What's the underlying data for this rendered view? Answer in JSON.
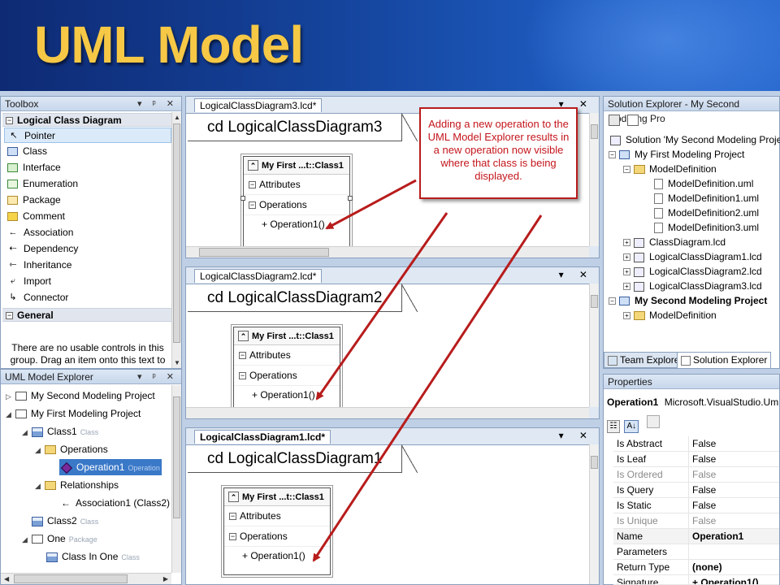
{
  "slide": {
    "title": "UML Model"
  },
  "toolbox": {
    "title": "Toolbox",
    "controls": "▾ ᵖ ✕",
    "section_logical": "Logical Class Diagram",
    "items": [
      {
        "label": "Pointer",
        "icon": "↖"
      },
      {
        "label": "Class",
        "icon": "▭"
      },
      {
        "label": "Interface",
        "icon": "▭"
      },
      {
        "label": "Enumeration",
        "icon": "▭"
      },
      {
        "label": "Package",
        "icon": "▭"
      },
      {
        "label": "Comment",
        "icon": "▭"
      },
      {
        "label": "Association",
        "icon": "←"
      },
      {
        "label": "Dependency",
        "icon": "⇠"
      },
      {
        "label": "Inheritance",
        "icon": "⇽"
      },
      {
        "label": "Import",
        "icon": "⤶"
      },
      {
        "label": "Connector",
        "icon": "↳"
      }
    ],
    "section_general": "General",
    "general_text": "There are no usable controls in this group. Drag an item onto this text to"
  },
  "explorer": {
    "title": "UML Model Explorer",
    "controls": "▾ ᵖ ✕",
    "rows": [
      {
        "label": "My Second Modeling Project",
        "hint": ""
      },
      {
        "label": "My First Modeling Project",
        "hint": ""
      },
      {
        "label": "Class1",
        "hint": "Class"
      },
      {
        "label": "Operations",
        "hint": ""
      },
      {
        "label": "Operation1",
        "hint": "Operation"
      },
      {
        "label": "Relationships",
        "hint": ""
      },
      {
        "label": "Association1 (Class2)",
        "hint": ""
      },
      {
        "label": "Class2",
        "hint": "Class"
      },
      {
        "label": "One",
        "hint": "Package"
      },
      {
        "label": "Class In One",
        "hint": "Class"
      }
    ]
  },
  "docs": [
    {
      "tab": "LogicalClassDiagram3.lcd*",
      "diagram": "cd LogicalClassDiagram3",
      "class_name": "My First ...t::Class1",
      "attributes": "Attributes",
      "operations": "Operations",
      "op": "+ Operation1()"
    },
    {
      "tab": "LogicalClassDiagram2.lcd*",
      "diagram": "cd LogicalClassDiagram2",
      "class_name": "My First ...t::Class1",
      "attributes": "Attributes",
      "operations": "Operations",
      "op": "+ Operation1()"
    },
    {
      "tab": "LogicalClassDiagram1.lcd*",
      "diagram": "cd LogicalClassDiagram1",
      "class_name": "My First ...t::Class1",
      "attributes": "Attributes",
      "operations": "Operations",
      "op": "+ Operation1()"
    }
  ],
  "doc_controls": "▾ ✕",
  "callout": {
    "text": "Adding a new operation to the UML Model Explorer results in a new operation now visible where that class is being displayed.",
    "color": "#c4161c"
  },
  "solution": {
    "title": "Solution Explorer - My Second Modeling Pro",
    "rows": [
      "Solution 'My Second Modeling Project'",
      "My First Modeling Project",
      "ModelDefinition",
      "ModelDefinition.uml",
      "ModelDefinition1.uml",
      "ModelDefinition2.uml",
      "ModelDefinition3.uml",
      "ClassDiagram.lcd",
      "LogicalClassDiagram1.lcd",
      "LogicalClassDiagram2.lcd",
      "LogicalClassDiagram3.lcd",
      "My Second Modeling Project",
      "ModelDefinition"
    ],
    "tab_team": "Team Explorer",
    "tab_solution": "Solution Explorer"
  },
  "properties": {
    "title": "Properties",
    "object": "Operation1",
    "type": "Microsoft.VisualStudio.Uml.Clas",
    "rows": [
      {
        "k": "Is Abstract",
        "v": "False",
        "ro": false,
        "b": false
      },
      {
        "k": "Is Leaf",
        "v": "False",
        "ro": false,
        "b": false
      },
      {
        "k": "Is Ordered",
        "v": "False",
        "ro": true,
        "b": false
      },
      {
        "k": "Is Query",
        "v": "False",
        "ro": false,
        "b": false
      },
      {
        "k": "Is Static",
        "v": "False",
        "ro": false,
        "b": false
      },
      {
        "k": "Is Unique",
        "v": "False",
        "ro": true,
        "b": false
      },
      {
        "k": "Name",
        "v": "Operation1",
        "ro": false,
        "b": true
      },
      {
        "k": "Parameters",
        "v": "",
        "ro": false,
        "b": false
      },
      {
        "k": "Return Type",
        "v": "(none)",
        "ro": false,
        "b": true
      },
      {
        "k": "Signature",
        "v": "+ Operation1()",
        "ro": false,
        "b": true
      }
    ]
  }
}
